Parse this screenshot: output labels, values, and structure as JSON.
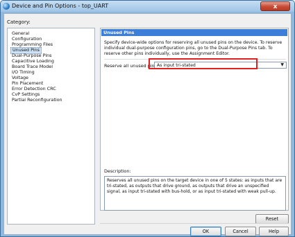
{
  "window": {
    "title": "Device and Pin Options - top_UART",
    "close_label": "x"
  },
  "category_label": "Category:",
  "categories": [
    "General",
    "Configuration",
    "Programming Files",
    "Unused Pins",
    "Dual-Purpose Pins",
    "Capacitive Loading",
    "Board Trace Model",
    "I/O Timing",
    "Voltage",
    "Pin Placement",
    "Error Detection CRC",
    "CvP Settings",
    "Partial Reconfiguration"
  ],
  "selected_category": "Unused Pins",
  "panel": {
    "header": "Unused Pins",
    "intro": "Specify device-wide options for reserving all unused pins on the device. To reserve individual dual-purpose configuration pins, go to the Dual-Purpose Pins tab. To reserve other pins individually, use the Assignment Editor.",
    "reserve_label": "Reserve all unused pins:",
    "reserve_value": "As input tri-stated",
    "description_label": "Description:",
    "description": "Reserves all unused pins on the target device in one of 5 states: as inputs that are tri-stated, as outputs that drive ground, as outputs that drive an unspecified signal, as input tri-stated with bus-hold, or as input tri-stated with weak pull-up.",
    "reset_label": "Reset"
  },
  "buttons": {
    "ok": "OK",
    "cancel": "Cancel",
    "help": "Help"
  },
  "colors": {
    "header_blue": "#3d7fd8",
    "highlight_red": "#e02020"
  }
}
